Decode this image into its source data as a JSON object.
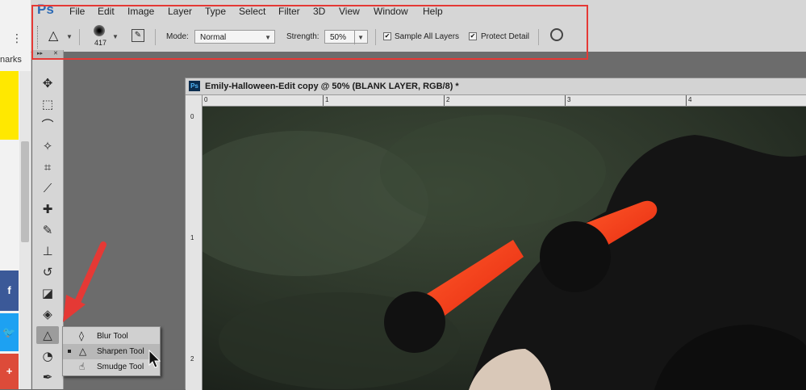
{
  "browser": {
    "menu_dots": "⋮",
    "bookmarks_fragment": "narks",
    "social": {
      "facebook": "f",
      "twitter": "🐦",
      "gplus": "+"
    }
  },
  "app": {
    "logo": "Ps",
    "menu": [
      "File",
      "Edit",
      "Image",
      "Layer",
      "Type",
      "Select",
      "Filter",
      "3D",
      "View",
      "Window",
      "Help"
    ]
  },
  "options": {
    "tool_icon": "sharpen-icon",
    "brush_size": "417",
    "mode_label": "Mode:",
    "mode_value": "Normal",
    "strength_label": "Strength:",
    "strength_value": "50%",
    "sample_all_layers_label": "Sample All Layers",
    "sample_all_layers_checked": true,
    "protect_detail_label": "Protect Detail",
    "protect_detail_checked": true
  },
  "document": {
    "title": "Emily-Halloween-Edit copy @ 50% (BLANK LAYER, RGB/8) *",
    "ruler_h_labels": [
      "0",
      "1",
      "2",
      "3",
      "4"
    ],
    "ruler_v_labels": [
      "0",
      "1",
      "2"
    ]
  },
  "tools": [
    {
      "name": "move-tool",
      "glyph": "✥"
    },
    {
      "name": "marquee-tool",
      "glyph": "⬚"
    },
    {
      "name": "lasso-tool",
      "glyph": "⌒"
    },
    {
      "name": "magic-wand-tool",
      "glyph": "✧"
    },
    {
      "name": "crop-tool",
      "glyph": "⌗"
    },
    {
      "name": "eyedropper-tool",
      "glyph": "⟋"
    },
    {
      "name": "healing-brush-tool",
      "glyph": "✚"
    },
    {
      "name": "brush-tool",
      "glyph": "✎"
    },
    {
      "name": "clone-stamp-tool",
      "glyph": "⊥"
    },
    {
      "name": "history-brush-tool",
      "glyph": "↺"
    },
    {
      "name": "eraser-tool",
      "glyph": "◪"
    },
    {
      "name": "paint-bucket-tool",
      "glyph": "◈"
    },
    {
      "name": "sharpen-tool",
      "glyph": "△"
    },
    {
      "name": "dodge-tool",
      "glyph": "◔"
    },
    {
      "name": "pen-tool",
      "glyph": "✒"
    }
  ],
  "flyout": [
    {
      "label": "Blur Tool",
      "icon": "blur-drop-icon",
      "glyph": "💧",
      "selected": false
    },
    {
      "label": "Sharpen Tool",
      "icon": "sharpen-icon",
      "glyph": "△",
      "selected": true
    },
    {
      "label": "Smudge Tool",
      "icon": "smudge-finger-icon",
      "glyph": "☝",
      "selected": false
    }
  ],
  "colors": {
    "annotation_red": "#e53935",
    "photo_background": "#2e3a2b",
    "hat_black": "#151515",
    "horn_orange": "#ff3d1a"
  }
}
